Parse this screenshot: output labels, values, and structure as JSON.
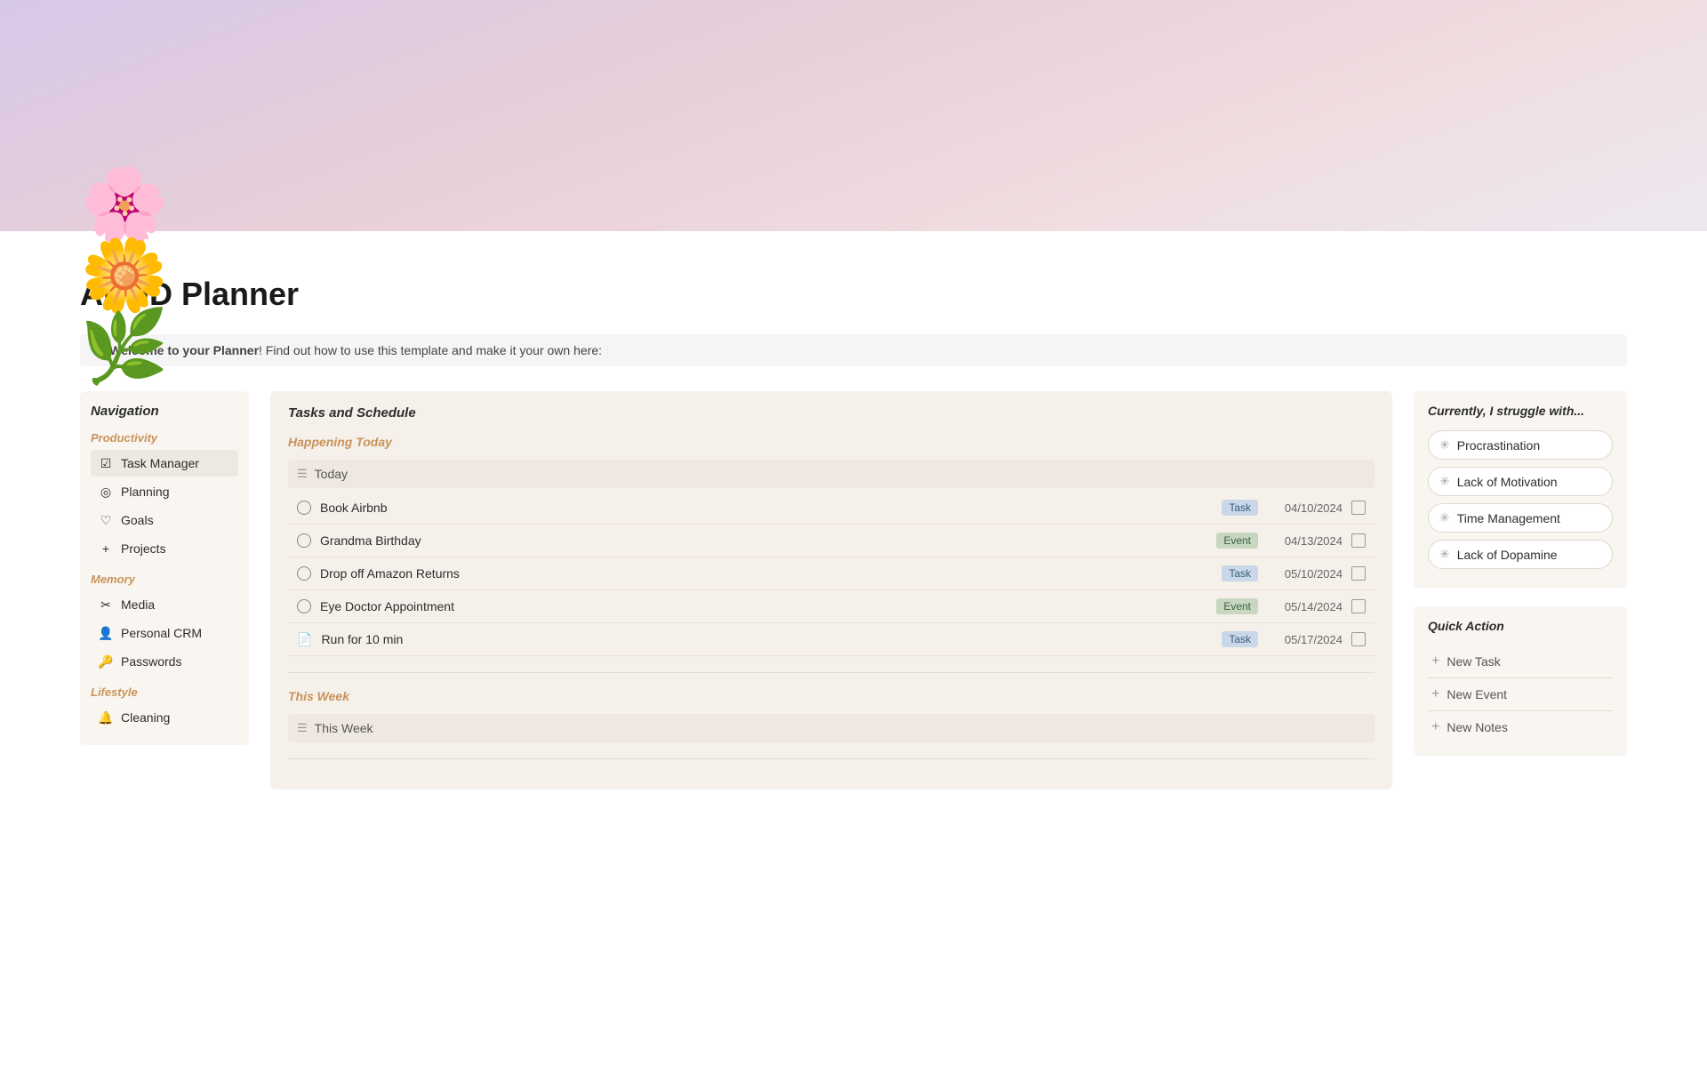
{
  "header": {
    "flower_emoji": "💐"
  },
  "page": {
    "title": "ADHD Planner",
    "welcome_text": "Welcome to your Planner",
    "welcome_suffix": "! Find out how to use this template and make it your own here:"
  },
  "sidebar": {
    "title": "Navigation",
    "sections": [
      {
        "label": "Productivity",
        "items": [
          {
            "icon": "☑",
            "label": "Task Manager",
            "active": true
          },
          {
            "icon": "◎",
            "label": "Planning"
          },
          {
            "icon": "♡",
            "label": "Goals"
          },
          {
            "icon": "+",
            "label": "Projects"
          }
        ]
      },
      {
        "label": "Memory",
        "items": [
          {
            "icon": "✂",
            "label": "Media"
          },
          {
            "icon": "👤",
            "label": "Personal CRM"
          },
          {
            "icon": "🔑",
            "label": "Passwords"
          }
        ]
      },
      {
        "label": "Lifestyle",
        "items": [
          {
            "icon": "🔔",
            "label": "Cleaning"
          }
        ]
      }
    ]
  },
  "tasks": {
    "panel_title": "Tasks and Schedule",
    "happening_today": {
      "label": "Happening Today",
      "table_label": "Today",
      "rows": [
        {
          "name": "Book Airbnb",
          "type": "Task",
          "date": "04/10/2024"
        },
        {
          "name": "Grandma Birthday",
          "type": "Event",
          "date": "04/13/2024"
        },
        {
          "name": "Drop off Amazon Returns",
          "type": "Task",
          "date": "05/10/2024"
        },
        {
          "name": "Eye Doctor Appointment",
          "type": "Event",
          "date": "05/14/2024"
        },
        {
          "name": "Run for 10 min",
          "type": "Task",
          "date": "05/17/2024",
          "icon": "doc"
        }
      ]
    },
    "this_week": {
      "label": "This Week",
      "table_label": "This Week"
    }
  },
  "struggles": {
    "title": "Currently, I struggle with...",
    "items": [
      "Procrastination",
      "Lack of Motivation",
      "Time Management",
      "Lack of Dopamine"
    ]
  },
  "quick_actions": {
    "title": "Quick Action",
    "items": [
      "New Task",
      "New Event",
      "New Notes"
    ]
  }
}
